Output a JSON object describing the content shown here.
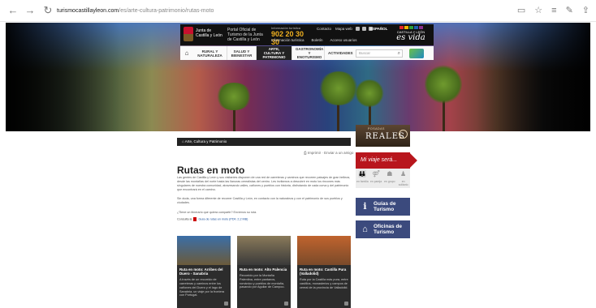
{
  "browser": {
    "url_host": "turismocastillayleon.com",
    "url_path": "/es/arte-cultura-patrimonio/rutas-moto"
  },
  "header": {
    "logo_text": "Junta de Castilla y León",
    "info_text": "Portal Oficial de Turismo de la Junta de Castilla y León",
    "phone_caption": "Información turística",
    "phone": "902 20 30 30",
    "links": [
      "Contacto",
      "Mapa web"
    ],
    "links2": [
      "Información turística",
      "Boletín",
      "Acceso usuarios"
    ],
    "lang": "ESPAÑOL",
    "brand_top": "CASTILLA Y LEÓN",
    "brand_script": "es vida",
    "brand_colors": [
      "#e3262b",
      "#f7b500",
      "#2c9e3b",
      "#1f5fae",
      "#8a2f8e"
    ]
  },
  "nav": {
    "items": [
      {
        "label": "RURAL Y NATURALEZA"
      },
      {
        "label": "SALUD Y BIENESTAR"
      },
      {
        "label": "ARTE, CULTURA Y PATRIMONIO"
      },
      {
        "label": "GASTRONOMÍA Y ENOTURISMO"
      },
      {
        "label": "ACTIVIDADES"
      }
    ],
    "search_placeholder": "Buscar"
  },
  "breadcrumb": "Arte, Cultura y Patrimonio",
  "print_tools": "Imprimir · Enviar a un amigo",
  "page": {
    "title": "Rutas en moto",
    "para1": "Las gentes de Castilla y León y sus visitantes disponen de una red de carreteras y caminos que recorren paisajes de gran belleza, desde las montañas del norte hasta las llanuras cerealistas del centro. Les invitamos a descubrir en moto los rincones más singulares de nuestra comunidad, atravesando valles, cañones y pueblos con historia, disfrutando de cada curva y del patrimonio que encontrará en el camino.",
    "para2": "Sin duda, una forma diferente de recorrer Castilla y León, en contacto con la naturaleza y con el patrimonio de sus pueblos y ciudades.",
    "para3": "¿Tiene un itinerario que quiera compartir? Envíenos su ruta.",
    "para4_pre": "Consulta la",
    "para4_link": "Guía de rutas en moto (PDF, 2,2 MB)"
  },
  "cards": [
    {
      "title": "Ruta en moto: Arribes del Duero - Sanabria",
      "desc": "A través de un recorrido de carreteras y caminos entre los cañones del Duero y el lago de Sanabria, un viaje por la frontera con Portugal.",
      "color_top": "#3b6fa8",
      "color_bottom": "#6b5a3a"
    },
    {
      "title": "Ruta en moto: Alto Palencia",
      "desc": "Recorrido por la Montaña Palentina, entre pantanos, románico y pueblos de montaña, pasando por Aguilar de Campoo.",
      "color_top": "#8a7a5a",
      "color_bottom": "#3a3a3a"
    },
    {
      "title": "Ruta en moto: Castilla Pura (Valladolid)",
      "desc": "Ruta por la Castilla más pura, entre castillos, monasterios y campos de cereal de la provincia de Valladolid.",
      "color_top": "#c0642e",
      "color_bottom": "#7a4a2a"
    }
  ],
  "sidebar": {
    "ad_small": "POSADAS",
    "ad_big": "REALES",
    "miviaje": "Mi viaje será...",
    "viaje_opts": [
      {
        "label": "en familia",
        "icon": "family-icon"
      },
      {
        "label": "en pareja",
        "icon": "couple-icon"
      },
      {
        "label": "en grupo",
        "icon": "group-icon"
      },
      {
        "label": "en solitario",
        "icon": "solo-icon"
      }
    ],
    "guias": "Guías de Turismo",
    "oficinas": "Oficinas de Turismo"
  }
}
